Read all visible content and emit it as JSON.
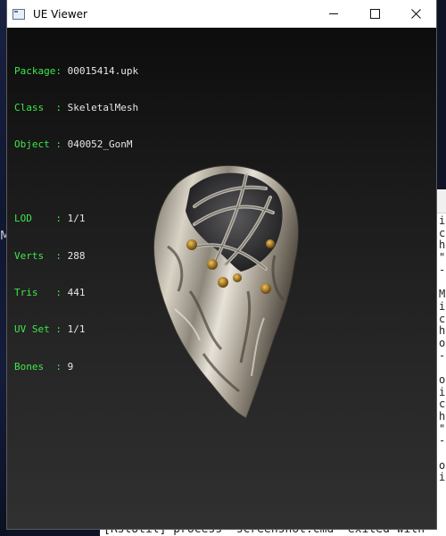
{
  "window": {
    "title": "UE Viewer",
    "controls": {
      "minimize": "minimize",
      "maximize": "maximize",
      "close": "close"
    }
  },
  "info": {
    "mesh_rows": [
      {
        "key": "Package:",
        "value": "00015414.upk"
      },
      {
        "key": "Class  :",
        "value": "SkeletalMesh"
      },
      {
        "key": "Object :",
        "value": "040052_GonM"
      }
    ],
    "stats_rows": [
      {
        "key": "LOD    :",
        "value": "1/1"
      },
      {
        "key": "Verts  :",
        "value": "288"
      },
      {
        "key": "Tris   :",
        "value": "441"
      },
      {
        "key": "UV Set :",
        "value": "1/1"
      },
      {
        "key": "Bones  :",
        "value": "9"
      }
    ]
  },
  "background": {
    "console_lines": [
      "i",
      "c",
      "h",
      "\"",
      "-",
      "",
      "M",
      "i",
      "c",
      "h",
      "o",
      "-",
      "",
      "o",
      "i",
      "c",
      "h",
      "\"",
      "-",
      "",
      "o",
      "i"
    ],
    "bottom_text": "[RstUtil] process \"screenshot.cmd\" exited with",
    "left_letter": "M"
  },
  "colors": {
    "info_key": "#3ee84a",
    "info_value": "#e6e6e6",
    "viewport_top": "#0d0d0d",
    "viewport_bottom": "#303030"
  }
}
